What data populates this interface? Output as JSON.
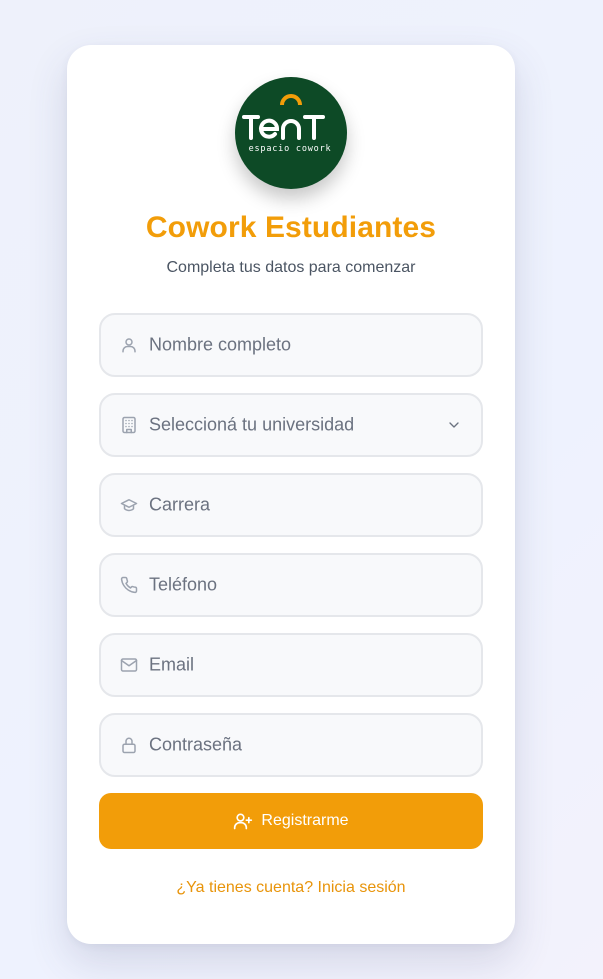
{
  "logo": {
    "wordmark": "TENT",
    "tagline": "espacio cowork",
    "background": "#0d4a26",
    "accent": "#f29d09"
  },
  "header": {
    "title": "Cowork Estudiantes",
    "subtitle": "Completa tus datos para comenzar"
  },
  "form": {
    "fields": [
      {
        "icon": "user-icon",
        "placeholder": "Nombre completo"
      },
      {
        "icon": "building-icon",
        "placeholder": "Seleccioná tu universidad",
        "type": "select"
      },
      {
        "icon": "graduation-cap-icon",
        "placeholder": "Carrera"
      },
      {
        "icon": "phone-icon",
        "placeholder": "Teléfono"
      },
      {
        "icon": "mail-icon",
        "placeholder": "Email"
      },
      {
        "icon": "lock-icon",
        "placeholder": "Contraseña"
      }
    ],
    "submit_label": "Registrarme",
    "submit_icon": "user-plus-icon",
    "login_link": "¿Ya tienes cuenta? Inicia sesión"
  },
  "colors": {
    "brand_accent": "#f29d09",
    "input_border": "#e5e7eb",
    "input_background": "#f8f9fb",
    "placeholder": "#6b7280"
  }
}
